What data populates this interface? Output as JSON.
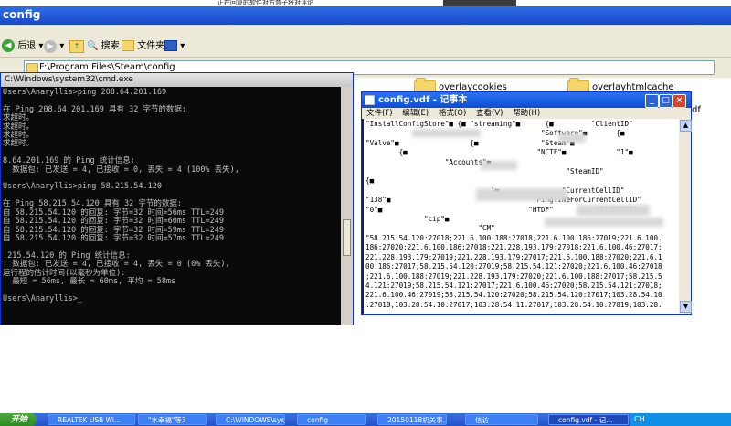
{
  "top_notice": "正在回复的软件对方盒子将对评论",
  "explorer": {
    "title": "config",
    "toolbar": {
      "back": "后退",
      "search": "搜索",
      "folders": "文件夹"
    },
    "address": "F:\\Program Files\\Steam\\config",
    "folders": [
      {
        "name": "overlaycookies"
      },
      {
        "name": "overlayhtmlcache"
      }
    ],
    "right_fragment": "df"
  },
  "cmd": {
    "title": "C:\\Windows\\system32\\cmd.exe",
    "lines": [
      "Users\\Anaryllis>ping 208.64.201.169",
      "",
      "在 Ping 208.64.201.169 具有 32 字节的数据:",
      "求超时。",
      "求超时。",
      "求超时。",
      "求超时。",
      "",
      "8.64.201.169 的 Ping 统计信息:",
      "  数据包: 已发送 = 4, 已接收 = 0, 丢失 = 4 (100% 丢失),",
      "",
      "Users\\Anaryllis>ping 58.215.54.120",
      "",
      "在 Ping 58.215.54.120 具有 32 字节的数据:",
      "自 58.215.54.120 的回复: 字节=32 时间=56ms TTL=249",
      "自 58.215.54.120 的回复: 字节=32 时间=60ms TTL=249",
      "自 58.215.54.120 的回复: 字节=32 时间=59ms TTL=249",
      "自 58.215.54.120 的回复: 字节=32 时间=57ms TTL=249",
      "",
      ".215.54.120 的 Ping 统计信息:",
      "  数据包: 已发送 = 4, 已接收 = 4, 丢失 = 0 (0% 丢失),",
      "运行程的估计时间(以毫秒为单位):",
      "  最短 = 56ms, 最长 = 60ms, 平均 = 58ms",
      "",
      "Users\\Anaryllis>_"
    ]
  },
  "notepad": {
    "title": "config.vdf - 记事本",
    "menu": [
      "文件(F)",
      "编辑(E)",
      "格式(O)",
      "查看(V)",
      "帮助(H)"
    ],
    "lines": [
      "\"InstallConfigStore\"■ {■ \"streaming\"■      {■         \"ClientID\"",
      "                                          \"Software\"■       {■",
      "\"Valve\"■                 {■               \"Steam\"■",
      "        {■                               \"NCTF\"■            \"1\"■",
      "                   \"Accounts\"■",
      "                                                \"SteamID\"",
      "{■",
      "                              }■               \"CurrentCellID\"",
      "\"138\"■                                  \"PingTimeForCurrentCellID\"",
      "\"0\"■                                   \"HTDF\"          \"864513176\"■",
      "              \"cip\"■",
      "                           \"CM\"",
      "\"58.215.54.120:27018;221.6.100.188:27018;221.6.100.186:27019;221.6.100.",
      "186:27020;221.6.100.186:27018;221.228.193.179:27018;221.6.100.46:27017;",
      "221.228.193.179:27019;221.228.193.179:27017;221.6.100.188:27020;221.6.1",
      "00.186:27017;58.215.54.120:27019;58.215.54.121:27020;221.6.100.46:27018",
      ";221.6.100.188:27019;221.228.193.179:27020;221.6.100.188:27017;58.215.5",
      "4.121:27019;58.215.54.121:27017;221.6.100.46:27020;58.215.54.121:27018;",
      "221.6.100.46:27019;58.215.54.120:27020;58.215.54.120:27017;103.28.54.10",
      ":27018;103.28.54.10:27017;103.28.54.11:27017;103.28.54.10:27019;103.28."
    ]
  },
  "taskbar": {
    "start": "开始",
    "tasks": [
      {
        "label": "REALTEK USB Wi..."
      },
      {
        "label": "\"水幸福\"等3"
      },
      {
        "label": "C:\\WINDOWS\\sys..."
      },
      {
        "label": "config"
      },
      {
        "label": "20150118机关事..."
      },
      {
        "label": "信访"
      },
      {
        "label": "config.vdf - 记..."
      }
    ],
    "tray": "CH"
  }
}
